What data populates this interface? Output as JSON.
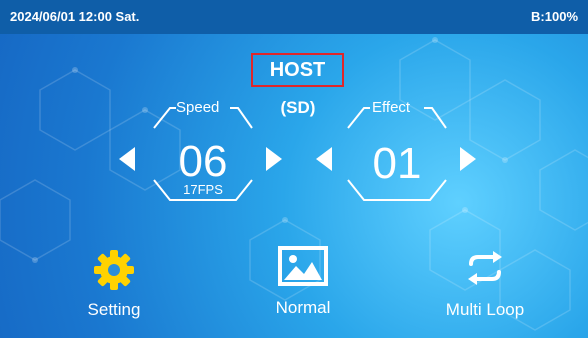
{
  "status": {
    "datetime": "2024/06/01 12:00 Sat.",
    "battery": "B:100%"
  },
  "mode": {
    "title": "HOST",
    "sub": "(SD)"
  },
  "speed": {
    "label": "Speed",
    "value": "06",
    "fps": "17FPS"
  },
  "effect": {
    "label": "Effect",
    "value": "01"
  },
  "buttons": [
    {
      "label": "Setting",
      "icon": "gear-icon"
    },
    {
      "label": "Normal",
      "icon": "image-icon"
    },
    {
      "label": "Multi Loop",
      "icon": "loop-icon"
    }
  ],
  "colors": {
    "statusbar": "#0f5ea8",
    "background": "#1a78d0",
    "accent_border": "#e0262a",
    "icon_yellow": "#ffd200"
  }
}
